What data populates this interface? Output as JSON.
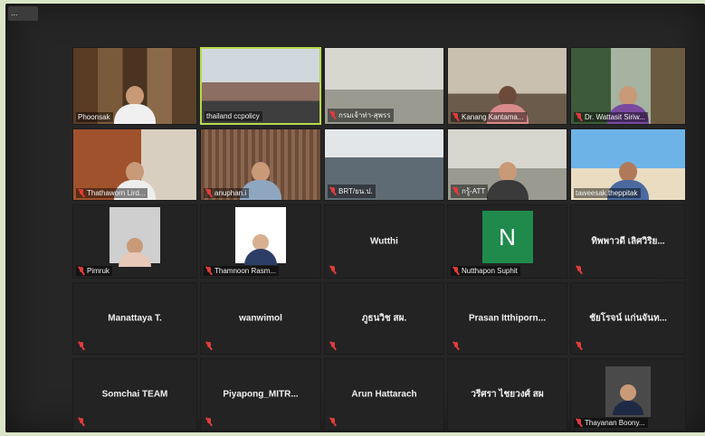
{
  "window": {
    "corner_label": "..."
  },
  "participants": [
    {
      "name": "Phoonsak"
    },
    {
      "name": "thailand ccpolicy"
    },
    {
      "name": "กรมเจ้าท่า-สุพรร"
    },
    {
      "name": "Kanang Kantama..."
    },
    {
      "name": "Dr. Wattasit Siriw..."
    },
    {
      "name": "Thathaworn Lird..."
    },
    {
      "name": "anuphan.i"
    },
    {
      "name": "BRT/ยน.ป."
    },
    {
      "name": "กรู้-ATT"
    },
    {
      "name": "taweesak.theppitak"
    },
    {
      "name": "Pimruk"
    },
    {
      "name": "Thamnoon Rasm..."
    },
    {
      "name": "Wutthi"
    },
    {
      "name": "Nutthapon Suphit",
      "initial": "N"
    },
    {
      "name": "ทิพพาวดี เลิศวิริย..."
    },
    {
      "name": "Manattaya T."
    },
    {
      "name": "wanwimol"
    },
    {
      "name": "ภูธนวิช สผ."
    },
    {
      "name": "Prasan Itthiporn..."
    },
    {
      "name": "ชัยโรจน์ แก่นจันท..."
    },
    {
      "name": "Somchai TEAM"
    },
    {
      "name": "Piyapong_MITR..."
    },
    {
      "name": "Arun Hattarach"
    },
    {
      "name": "วรีศรา ไชยวงศ์ สผ"
    },
    {
      "name": "Thayanan Boony..."
    }
  ],
  "colors": {
    "active_speaker": "#b6d94a",
    "muted": "#e23b3b",
    "avatar_bg": "#1f8a4c"
  }
}
